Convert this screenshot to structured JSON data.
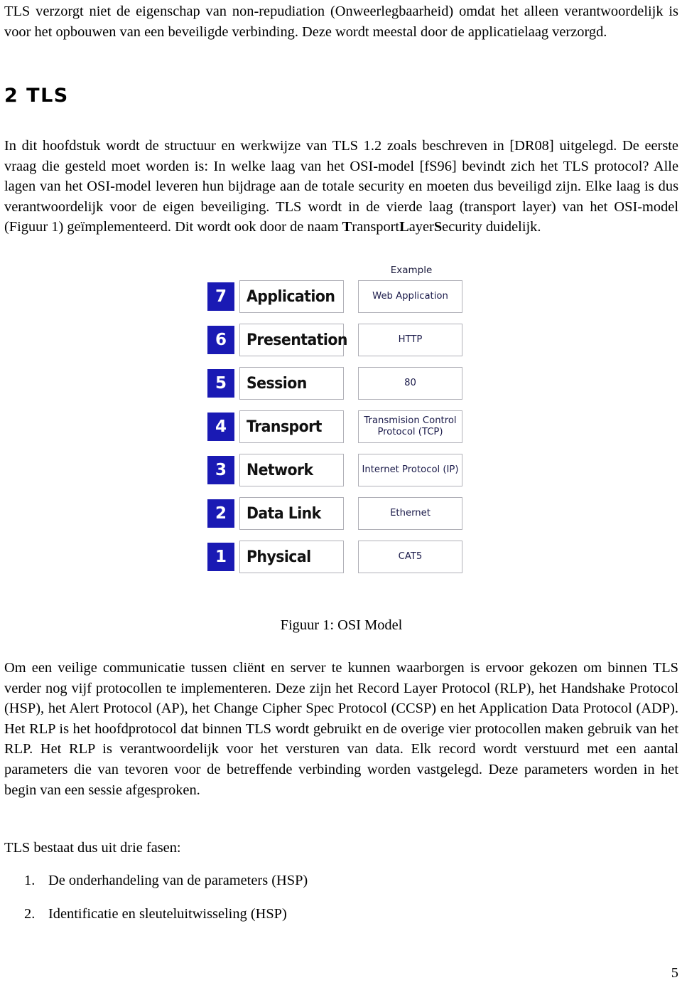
{
  "document": {
    "page_number": "5",
    "chapter_heading": "2 TLS",
    "paragraphs": {
      "intro": "TLS verzorgt niet de eigenschap van non-repudiation (Onweerlegbaarheid) omdat het alleen verantwoordelijk is voor het opbouwen van een beveiligde verbinding. Deze wordt meestal door de applicatielaag verzorgd.",
      "main_part1": "In dit hoofdstuk wordt de structuur en werkwijze van TLS 1.2 zoals beschreven in [DR08] uitgelegd. De eerste vraag die gesteld moet worden is: In welke laag van het OSI-model [fS96] bevindt zich het TLS protocol? Alle lagen van het OSI-model leveren hun bijdrage aan de totale security en moeten dus beveiligd zijn. Elke laag is dus verantwoordelijk voor de eigen beveiliging. TLS wordt in de vierde laag (transport layer) van het OSI-model (Figuur 1) geïmplementeerd. Dit wordt ook door de naam ",
      "main_bold_T": "T",
      "main_rest_ransport": "ransport",
      "main_bold_L": "L",
      "main_rest_ayer": "ayer",
      "main_bold_S": "S",
      "main_rest_ecurity": "ecurity duidelijk.",
      "after_figure": "Om een veilige communicatie tussen cliënt en server te kunnen waarborgen is ervoor gekozen om binnen TLS verder nog vijf protocollen te implementeren. Deze zijn het Record Layer Protocol (RLP), het Handshake Protocol (HSP), het Alert Protocol (AP), het Change Cipher Spec Protocol (CCSP) en het Application Data Protocol (ADP). Het RLP is het hoofdprotocol dat binnen TLS wordt gebruikt en de overige vier protocollen maken gebruik van het RLP. Het RLP is verantwoordelijk voor het versturen van data. Elk record wordt verstuurd met een aantal parameters die van tevoren voor de betreffende verbinding worden vastgelegd. Deze parameters worden in het begin van een sessie afgesproken.",
      "fasen_intro": "TLS bestaat dus uit drie fasen:"
    },
    "list_fasen": [
      {
        "marker": "1.",
        "text": "De onderhandeling van de parameters (HSP)"
      },
      {
        "marker": "2.",
        "text": "Identificatie en sleuteluitwisseling (HSP)"
      }
    ],
    "figure": {
      "caption": "Figuur 1: OSI Model",
      "example_column_header": "Example",
      "accent_color": "#1a1ab4",
      "example_text_color": "#1a1a4a",
      "box_border_color": "#b0b0b8",
      "rows": [
        {
          "number": "7",
          "layer": "Application",
          "example": "Web Application"
        },
        {
          "number": "6",
          "layer": "Presentation",
          "example": "HTTP"
        },
        {
          "number": "5",
          "layer": "Session",
          "example": "80"
        },
        {
          "number": "4",
          "layer": "Transport",
          "example": "Transmision Control Protocol (TCP)"
        },
        {
          "number": "3",
          "layer": "Network",
          "example": "Internet Protocol (IP)"
        },
        {
          "number": "2",
          "layer": "Data Link",
          "example": "Ethernet"
        },
        {
          "number": "1",
          "layer": "Physical",
          "example": "CAT5"
        }
      ]
    }
  }
}
